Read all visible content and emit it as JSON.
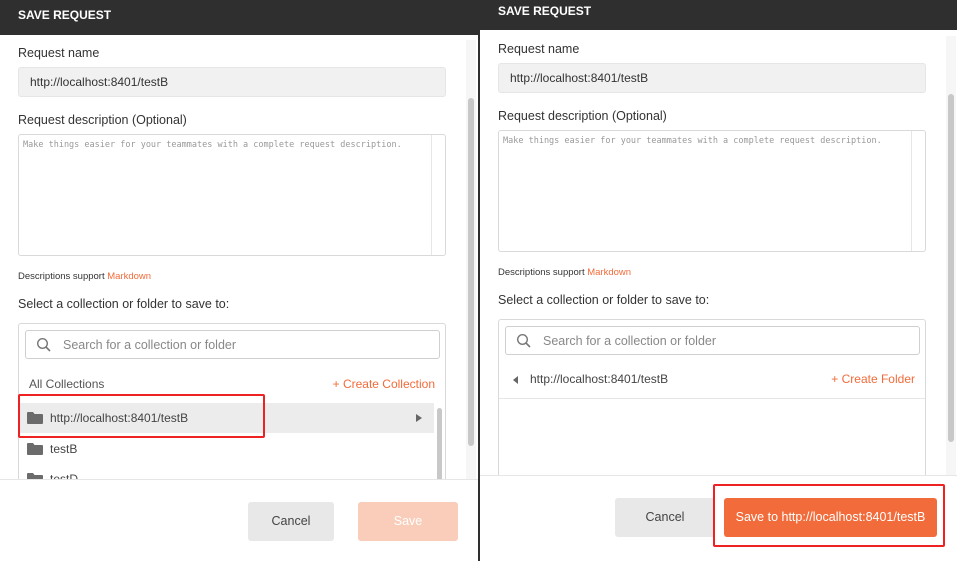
{
  "left": {
    "title": "SAVE REQUEST",
    "request_name_label": "Request name",
    "request_name_value": "http://localhost:8401/testB",
    "description_label": "Request description (Optional)",
    "description_placeholder": "Make things easier for your teammates with a complete request description.",
    "hint_prefix": "Descriptions support",
    "hint_link": "Markdown",
    "select_label": "Select a collection or folder to save to:",
    "search_placeholder": "Search for a collection or folder",
    "all_collections_label": "All Collections",
    "create_collection_label": "+ Create Collection",
    "items": [
      {
        "label": "http://localhost:8401/testB",
        "icon": "folder-icon"
      },
      {
        "label": "testB",
        "icon": "folder-icon"
      },
      {
        "label": "testD",
        "icon": "folder-icon"
      }
    ],
    "cancel_label": "Cancel",
    "save_label": "Save"
  },
  "right": {
    "title": "SAVE REQUEST",
    "request_name_label": "Request name",
    "request_name_value": "http://localhost:8401/testB",
    "description_label": "Request description (Optional)",
    "description_placeholder": "Make things easier for your teammates with a complete request description.",
    "hint_prefix": "Descriptions support",
    "hint_link": "Markdown",
    "select_label": "Select a collection or folder to save to:",
    "search_placeholder": "Search for a collection or folder",
    "breadcrumb_label": "http://localhost:8401/testB",
    "create_folder_label": "+ Create Folder",
    "cancel_label": "Cancel",
    "save_label": "Save to http://localhost:8401/testB"
  },
  "colors": {
    "accent": "#f26b3a",
    "header_bg": "#2f2f2f",
    "highlight_border": "#e22222"
  }
}
